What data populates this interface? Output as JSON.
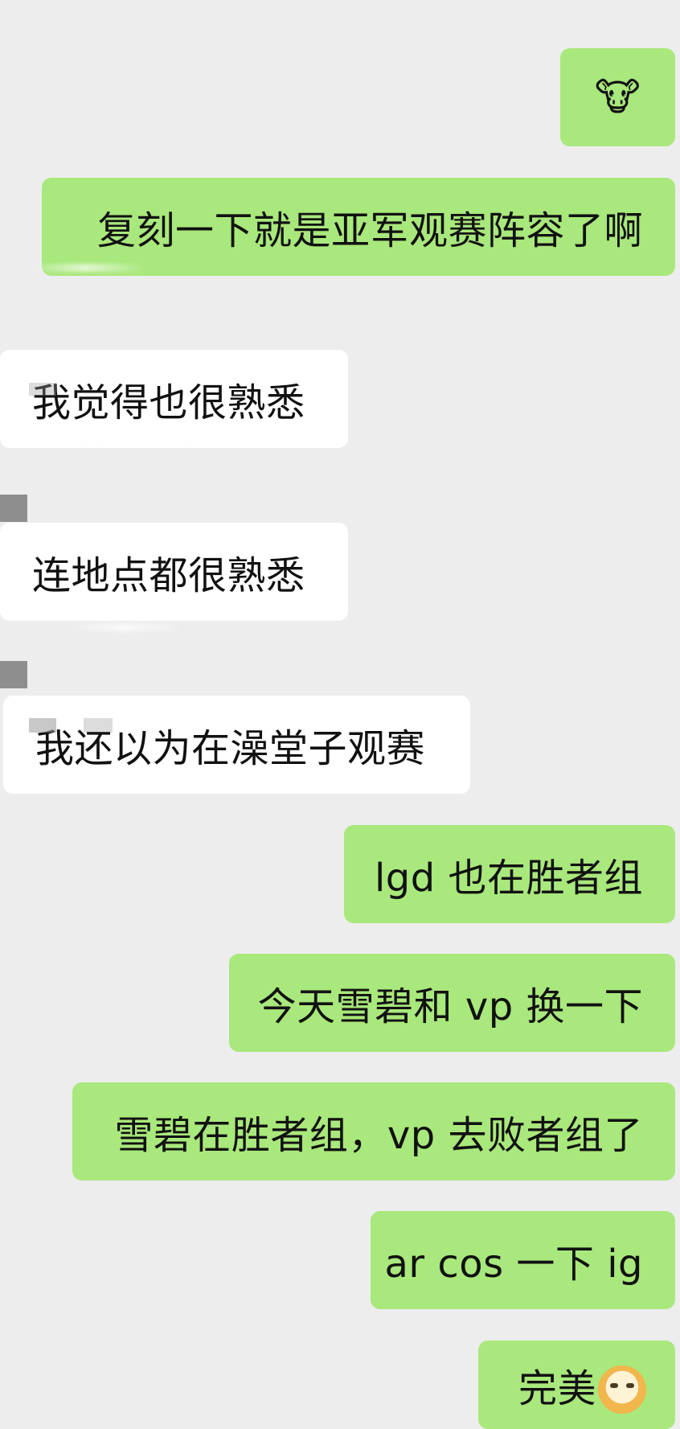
{
  "messages": [
    {
      "id": "m1",
      "side": "me",
      "text": "",
      "emoji": "🐮"
    },
    {
      "id": "m2",
      "side": "me",
      "text": "复刻一下就是亚军观赛阵容了啊"
    },
    {
      "id": "m3",
      "side": "them",
      "text": "我觉得也很熟悉"
    },
    {
      "id": "m4",
      "side": "them",
      "text": "连地点都很熟悉"
    },
    {
      "id": "m5",
      "side": "them",
      "text": "我还以为在澡堂子观赛"
    },
    {
      "id": "m6",
      "side": "me",
      "text": "lgd 也在胜者组"
    },
    {
      "id": "m7",
      "side": "me",
      "text": "今天雪碧和 vp 换一下"
    },
    {
      "id": "m8",
      "side": "me",
      "text": "雪碧在胜者组，vp 去败者组了"
    },
    {
      "id": "m9",
      "side": "me",
      "text": "ar cos 一下 ig"
    },
    {
      "id": "m10",
      "side": "me",
      "text": "完美",
      "emoji": "dog-face-emoji"
    }
  ],
  "colors": {
    "background": "#ededed",
    "my_bubble": "#a9e87c",
    "their_bubble": "#ffffff",
    "text": "#111111"
  }
}
